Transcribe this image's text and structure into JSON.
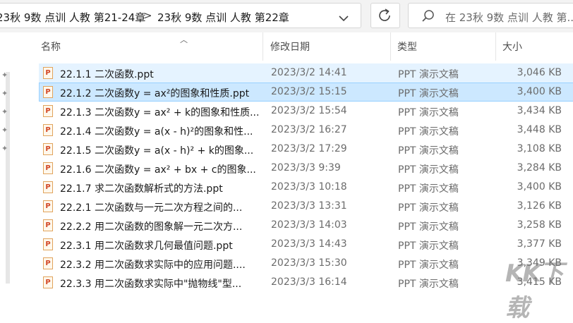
{
  "address_bar": {
    "crumbs": [
      "23秋 9数 点训 人教 第21-24章",
      "23秋 9数 点训 人教 第22章"
    ],
    "separator": ">"
  },
  "search": {
    "placeholder": "在 23秋 9数 点训 人教 第..."
  },
  "columns": {
    "name": "名称",
    "date": "修改日期",
    "type": "类型",
    "size": "大小"
  },
  "files": [
    {
      "name": "22.1.1  二次函数.ppt",
      "date": "2023/3/2 14:41",
      "type": "PPT 演示文稿",
      "size": "3,046 KB",
      "state": "hover"
    },
    {
      "name": "22.1.2  二次函数y = ax²的图象和性质.ppt",
      "date": "2023/3/2 15:15",
      "type": "PPT 演示文稿",
      "size": "3,400 KB",
      "state": "selected"
    },
    {
      "name": "22.1.3  二次函数y = ax² + k的图象和性质...",
      "date": "2023/3/2 15:54",
      "type": "PPT 演示文稿",
      "size": "3,434 KB",
      "state": ""
    },
    {
      "name": "22.1.4  二次函数y = a(x - h)²的图象和性...",
      "date": "2023/3/2 16:27",
      "type": "PPT 演示文稿",
      "size": "3,448 KB",
      "state": ""
    },
    {
      "name": "22.1.5  二次函数y = a(x - h)² + k的图象...",
      "date": "2023/3/2 17:29",
      "type": "PPT 演示文稿",
      "size": "3,108 KB",
      "state": ""
    },
    {
      "name": "22.1.6  二次函数y = ax² + bx + c的图象...",
      "date": "2023/3/3 9:39",
      "type": "PPT 演示文稿",
      "size": "3,284 KB",
      "state": ""
    },
    {
      "name": "22.1.7  求二次函数解析式的方法.ppt",
      "date": "2023/3/3 10:18",
      "type": "PPT 演示文稿",
      "size": "3,400 KB",
      "state": ""
    },
    {
      "name": "22.2.1  二次函数与一元二次方程之间的...",
      "date": "2023/3/3 13:31",
      "type": "PPT 演示文稿",
      "size": "3,126 KB",
      "state": ""
    },
    {
      "name": "22.2.2  用二次函数的图象解一元二次方...",
      "date": "2023/3/3 14:03",
      "type": "PPT 演示文稿",
      "size": "3,258 KB",
      "state": ""
    },
    {
      "name": "22.3.1  用二次函数求几何最值问题.ppt",
      "date": "2023/3/3 14:43",
      "type": "PPT 演示文稿",
      "size": "3,377 KB",
      "state": ""
    },
    {
      "name": "22.3.2  用二次函数求实际中的应用问题....",
      "date": "2023/3/3 15:30",
      "type": "PPT 演示文稿",
      "size": "3,349 KB",
      "state": ""
    },
    {
      "name": "22.3.3  用二次函数求实际中\"抛物线\"型...",
      "date": "2023/3/3 16:14",
      "type": "PPT 演示文稿",
      "size": "3,415 KB",
      "state": ""
    }
  ],
  "watermark": {
    "text": "KK下载",
    "url": "www.kkx.net"
  },
  "icons": {
    "file": "ppt-file-icon",
    "refresh": "refresh-icon",
    "search": "search-icon",
    "dropdown": "chevron-down-icon",
    "sort": "sort-up-icon",
    "pin": "pin-icon"
  }
}
